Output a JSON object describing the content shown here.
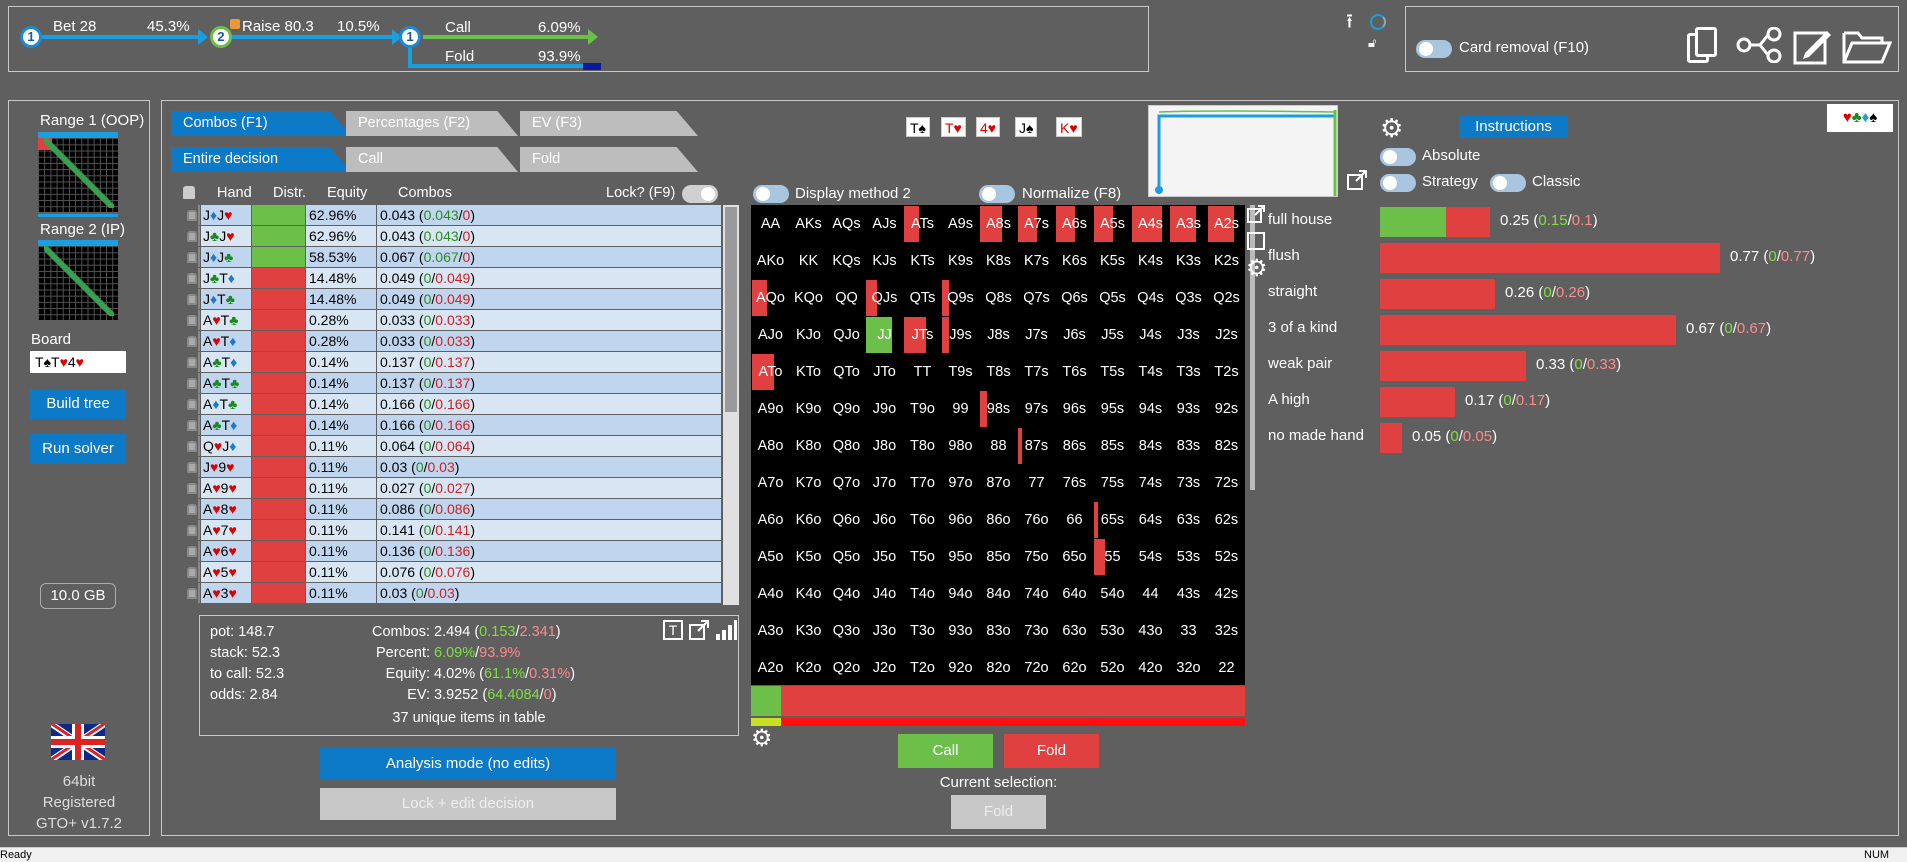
{
  "tree": {
    "node1": "1",
    "node2": "2",
    "node3": "1",
    "bet_label": "Bet 28",
    "bet_pct": "45.3%",
    "raise_label": "Raise 80.3",
    "raise_pct": "10.5%",
    "call_label": "Call",
    "call_pct": "6.09%",
    "fold_label": "Fold",
    "fold_pct": "93.9%"
  },
  "card_removal": "Card removal (F10)",
  "sidebar": {
    "range1": "Range 1 (OOP)",
    "range2": "Range 2 (IP)",
    "board_label": "Board",
    "board_value": "T♠T♥4♥",
    "build_tree": "Build tree",
    "run_solver": "Run solver",
    "memory": "10.0 GB",
    "bits": "64bit",
    "registered": "Registered",
    "version": "GTO+ v1.7.2"
  },
  "tabs": {
    "combos": "Combos (F1)",
    "percentages": "Percentages (F2)",
    "ev": "EV (F3)",
    "entire": "Entire decision",
    "call": "Call",
    "fold": "Fold"
  },
  "board_cards": [
    "T♠",
    "T♥",
    "4♥",
    "J♠",
    "K♥"
  ],
  "table": {
    "headers": {
      "hand": "Hand",
      "distr": "Distr.",
      "equity": "Equity",
      "combos": "Combos",
      "lock": "Lock? (F9)"
    },
    "rows": [
      {
        "hand": "J♦J♥",
        "eq": "62.96%",
        "c": "0.043",
        "g": "0.043",
        "r": "0",
        "win": true
      },
      {
        "hand": "J♣J♥",
        "eq": "62.96%",
        "c": "0.043",
        "g": "0.043",
        "r": "0",
        "win": true
      },
      {
        "hand": "J♦J♣",
        "eq": "58.53%",
        "c": "0.067",
        "g": "0.067",
        "r": "0",
        "win": true
      },
      {
        "hand": "J♣T♦",
        "eq": "14.48%",
        "c": "0.049",
        "g": "0",
        "r": "0.049",
        "win": false
      },
      {
        "hand": "J♦T♣",
        "eq": "14.48%",
        "c": "0.049",
        "g": "0",
        "r": "0.049",
        "win": false
      },
      {
        "hand": "A♥T♣",
        "eq": "0.28%",
        "c": "0.033",
        "g": "0",
        "r": "0.033",
        "win": false
      },
      {
        "hand": "A♥T♦",
        "eq": "0.28%",
        "c": "0.033",
        "g": "0",
        "r": "0.033",
        "win": false
      },
      {
        "hand": "A♣T♦",
        "eq": "0.14%",
        "c": "0.137",
        "g": "0",
        "r": "0.137",
        "win": false
      },
      {
        "hand": "A♣T♣",
        "eq": "0.14%",
        "c": "0.137",
        "g": "0",
        "r": "0.137",
        "win": false
      },
      {
        "hand": "A♦T♣",
        "eq": "0.14%",
        "c": "0.166",
        "g": "0",
        "r": "0.166",
        "win": false
      },
      {
        "hand": "A♣T♦",
        "eq": "0.14%",
        "c": "0.166",
        "g": "0",
        "r": "0.166",
        "win": false
      },
      {
        "hand": "Q♥J♦",
        "eq": "0.11%",
        "c": "0.064",
        "g": "0",
        "r": "0.064",
        "win": false
      },
      {
        "hand": "J♥9♥",
        "eq": "0.11%",
        "c": "0.03",
        "g": "0",
        "r": "0.03",
        "win": false
      },
      {
        "hand": "A♥9♥",
        "eq": "0.11%",
        "c": "0.027",
        "g": "0",
        "r": "0.027",
        "win": false
      },
      {
        "hand": "A♥8♥",
        "eq": "0.11%",
        "c": "0.086",
        "g": "0",
        "r": "0.086",
        "win": false
      },
      {
        "hand": "A♥7♥",
        "eq": "0.11%",
        "c": "0.141",
        "g": "0",
        "r": "0.141",
        "win": false
      },
      {
        "hand": "A♥6♥",
        "eq": "0.11%",
        "c": "0.136",
        "g": "0",
        "r": "0.136",
        "win": false
      },
      {
        "hand": "A♥5♥",
        "eq": "0.11%",
        "c": "0.076",
        "g": "0",
        "r": "0.076",
        "win": false
      },
      {
        "hand": "A♥3♥",
        "eq": "0.11%",
        "c": "0.03",
        "g": "0",
        "r": "0.03",
        "win": false
      }
    ]
  },
  "summary": {
    "pot": "pot: 148.7",
    "stack": "stack: 52.3",
    "tocall": "to call: 52.3",
    "odds": "odds: 2.84",
    "combos_label": "Combos:",
    "combos_total": "2.494",
    "combos_g": "0.153",
    "combos_r": "2.341",
    "percent_label": "Percent:",
    "percent_g": "6.09%",
    "percent_r": "93.9%",
    "equity_label": "Equity:",
    "equity_total": "4.02%",
    "equity_g": "61.1%",
    "equity_r": "0.31%",
    "ev_label": "EV:",
    "ev_total": "3.9252",
    "ev_g": "64.4084",
    "ev_r": "0",
    "unique": "37 unique items in table"
  },
  "analysis_mode": "Analysis mode (no edits)",
  "lock_edit": "Lock + edit decision",
  "display_method": "Display method 2",
  "normalize": "Normalize (F8)",
  "grid": [
    [
      "AA",
      "AKs",
      "AQs",
      "AJs",
      "ATs",
      "A9s",
      "A8s",
      "A7s",
      "A6s",
      "A5s",
      "A4s",
      "A3s",
      "A2s"
    ],
    [
      "AKo",
      "KK",
      "KQs",
      "KJs",
      "KTs",
      "K9s",
      "K8s",
      "K7s",
      "K6s",
      "K5s",
      "K4s",
      "K3s",
      "K2s"
    ],
    [
      "AQo",
      "KQo",
      "QQ",
      "QJs",
      "QTs",
      "Q9s",
      "Q8s",
      "Q7s",
      "Q6s",
      "Q5s",
      "Q4s",
      "Q3s",
      "Q2s"
    ],
    [
      "AJo",
      "KJo",
      "QJo",
      "JJ",
      "JTs",
      "J9s",
      "J8s",
      "J7s",
      "J6s",
      "J5s",
      "J4s",
      "J3s",
      "J2s"
    ],
    [
      "ATo",
      "KTo",
      "QTo",
      "JTo",
      "TT",
      "T9s",
      "T8s",
      "T7s",
      "T6s",
      "T5s",
      "T4s",
      "T3s",
      "T2s"
    ],
    [
      "A9o",
      "K9o",
      "Q9o",
      "J9o",
      "T9o",
      "99",
      "98s",
      "97s",
      "96s",
      "95s",
      "94s",
      "93s",
      "92s"
    ],
    [
      "A8o",
      "K8o",
      "Q8o",
      "J8o",
      "T8o",
      "98o",
      "88",
      "87s",
      "86s",
      "85s",
      "84s",
      "83s",
      "82s"
    ],
    [
      "A7o",
      "K7o",
      "Q7o",
      "J7o",
      "T7o",
      "97o",
      "87o",
      "77",
      "76s",
      "75s",
      "74s",
      "73s",
      "72s"
    ],
    [
      "A6o",
      "K6o",
      "Q6o",
      "J6o",
      "T6o",
      "96o",
      "86o",
      "76o",
      "66",
      "65s",
      "64s",
      "63s",
      "62s"
    ],
    [
      "A5o",
      "K5o",
      "Q5o",
      "J5o",
      "T5o",
      "95o",
      "85o",
      "75o",
      "65o",
      "55",
      "54s",
      "53s",
      "52s"
    ],
    [
      "A4o",
      "K4o",
      "Q4o",
      "J4o",
      "T4o",
      "94o",
      "84o",
      "74o",
      "64o",
      "54o",
      "44",
      "43s",
      "42s"
    ],
    [
      "A3o",
      "K3o",
      "Q3o",
      "J3o",
      "T3o",
      "93o",
      "83o",
      "73o",
      "63o",
      "53o",
      "43o",
      "33",
      "32s"
    ],
    [
      "A2o",
      "K2o",
      "Q2o",
      "J2o",
      "T2o",
      "92o",
      "82o",
      "72o",
      "62o",
      "52o",
      "42o",
      "32o",
      "22"
    ]
  ],
  "action_buttons": {
    "call": "Call",
    "fold": "Fold"
  },
  "current_selection_label": "Current selection:",
  "current_selection_value": "Fold",
  "right": {
    "instructions": "Instructions",
    "absolute": "Absolute",
    "strategy": "Strategy",
    "classic": "Classic",
    "suits": "♥♣♦♠"
  },
  "categories": [
    {
      "label": "full house",
      "total": "0.25",
      "g": "0.15",
      "r": "0.1",
      "green_fraction": 0.6
    },
    {
      "label": "flush",
      "total": "0.77",
      "g": "0",
      "r": "0.77",
      "green_fraction": 0
    },
    {
      "label": "straight",
      "total": "0.26",
      "g": "0",
      "r": "0.26",
      "green_fraction": 0
    },
    {
      "label": "3 of a kind",
      "total": "0.67",
      "g": "0",
      "r": "0.67",
      "green_fraction": 0
    },
    {
      "label": "weak pair",
      "total": "0.33",
      "g": "0",
      "r": "0.33",
      "green_fraction": 0
    },
    {
      "label": "A high",
      "total": "0.17",
      "g": "0",
      "r": "0.17",
      "green_fraction": 0
    },
    {
      "label": "no made hand",
      "total": "0.05",
      "g": "0",
      "r": "0.05",
      "green_fraction": 0
    }
  ],
  "status": {
    "left": "Ready",
    "right": "NUM"
  },
  "colors": {
    "accent": "#1a8ad4",
    "call": "#6cc04a",
    "fold": "#e04040"
  }
}
